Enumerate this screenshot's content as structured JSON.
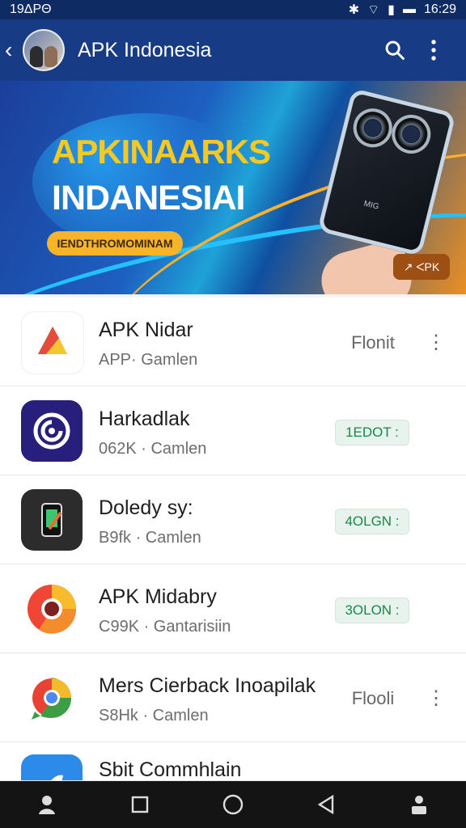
{
  "status": {
    "left": "19ΔPΘ",
    "right": "16:29"
  },
  "appbar": {
    "title": "APK Indonesia",
    "back_icon": "back-arrow-icon",
    "search_icon": "search-icon",
    "more_icon": "more-vertical-icon"
  },
  "banner": {
    "title1": "APKINAARKS",
    "title2": "INDANESIAI",
    "pill": "IENDTHROMOMINAM",
    "badge": "↗ ᐸPK",
    "phone_label": "MIG"
  },
  "apps": [
    {
      "name": "APK Nidar",
      "subtitle": "APP· Gamlen",
      "action": "Flonit",
      "action_style": "plain"
    },
    {
      "name": "Harkadlak",
      "subtitle": "062K · Camlen",
      "action": "1EDOT :",
      "action_style": "green"
    },
    {
      "name": "Doledy sy:",
      "subtitle": "B9fk · Camlen",
      "action": "4OLGN :",
      "action_style": "green"
    },
    {
      "name": "APK Midabry",
      "subtitle": "C99K · Gantarisiin",
      "action": "3OLON :",
      "action_style": "green"
    },
    {
      "name": "Mers Cierback Inoapilak",
      "subtitle": "S8Hk · Camlen",
      "action": "Flooli",
      "action_style": "plain"
    },
    {
      "name": "Sbit Commhlain",
      "subtitle": "",
      "action": "",
      "action_style": "plain"
    }
  ],
  "nav": {
    "items": [
      "profile-icon",
      "square-icon",
      "circle-icon",
      "back-triangle-icon",
      "person-badge-icon"
    ]
  }
}
